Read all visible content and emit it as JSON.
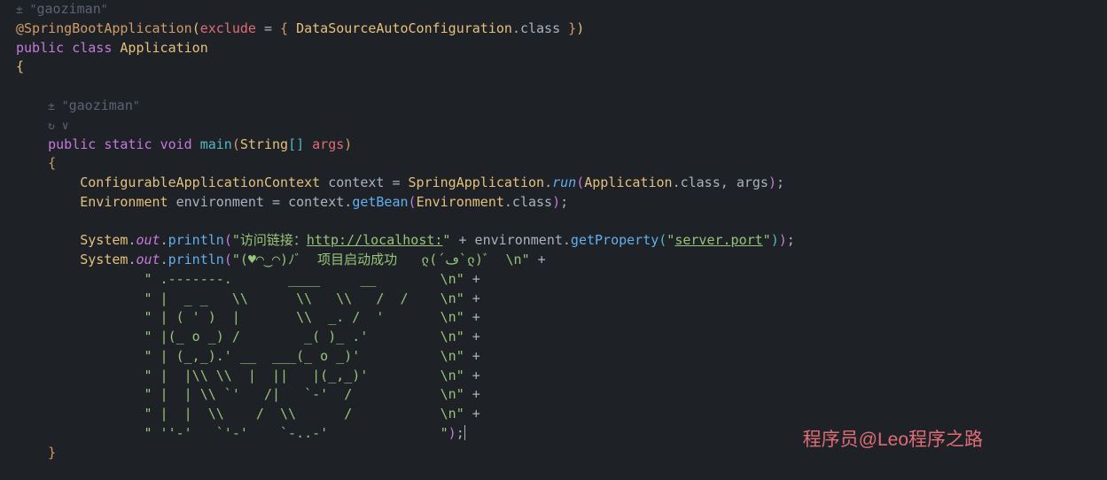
{
  "hints": {
    "author1": "gaoziman",
    "author2": "gaoziman"
  },
  "code": {
    "annotation_name": "@SpringBootApplication",
    "annotation_param": "exclude",
    "annotation_value": "DataSourceAutoConfiguration",
    "annotation_suffix": ".class",
    "public": "public",
    "class_kw": "class",
    "class_name": "Application",
    "static": "static",
    "void": "void",
    "main": "main",
    "string_type": "String",
    "args": "args",
    "ctx_type": "ConfigurableApplicationContext",
    "ctx_var": "context",
    "spring_app": "SpringApplication",
    "run": "run",
    "app_class": "Application",
    "class_suffix": ".class",
    "env_type": "Environment",
    "env_var": "environment",
    "get_bean": "getBean",
    "env_class": "Environment",
    "system": "System",
    "out": "out",
    "println": "println",
    "str_visit": "\"访问链接：",
    "str_url": "http://localhost:",
    "str_quote_close": "\"",
    "get_property": "getProperty",
    "str_server_port": "server.port",
    "str_banner_start": "\"(♥◠‿◠)ﾉﾞ  项目启动成功   ლ(´ڡ`ლ)ﾞ  \\n\"",
    "ascii_lines": [
      "                \" .-------.       ____     __        \\n\" +",
      "                \" |  _ _   \\\\      \\\\   \\\\   /  /    \\n\" +",
      "                \" | ( ' )  |       \\\\  _. /  '       \\n\" +",
      "                \" |(_ o _) /        _( )_ .'         \\n\" +",
      "                \" | (_,_).' __  ___(_ o _)'          \\n\" +",
      "                \" |  |\\\\ \\\\  |  ||   |(_,_)'         \\n\" +",
      "                \" |  | \\\\ `'   /|   `-'  /           \\n\" +",
      "                \" |  |  \\\\    /  \\\\      /           \\n\" +",
      "                \" ''-'   `'-'    `-..-'              \");"
    ]
  },
  "watermark": "程序员@Leo程序之路"
}
